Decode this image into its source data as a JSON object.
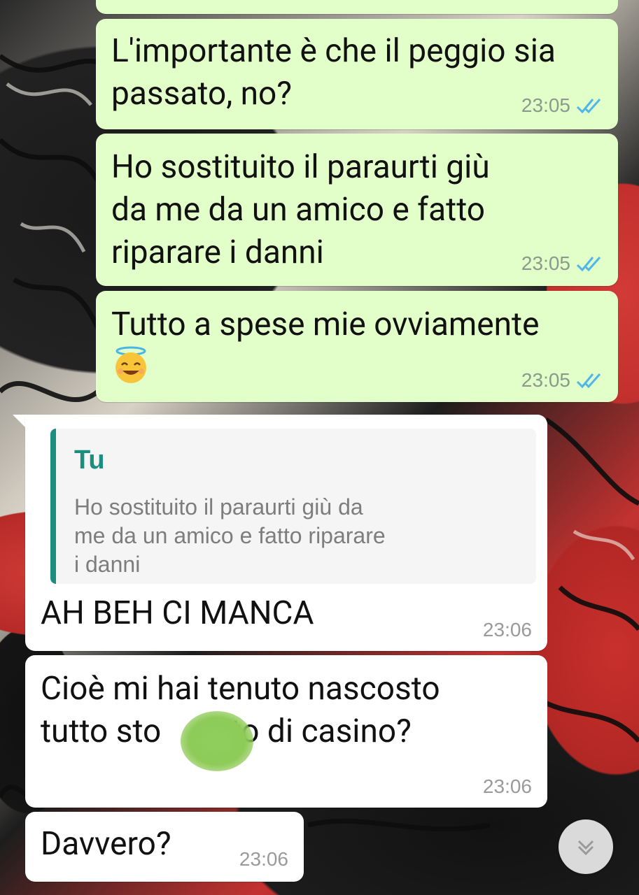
{
  "messages": [
    {
      "direction": "outgoing",
      "lines": [
        "L'importante è che il peggio sia",
        "passato, no?"
      ],
      "time": "23:05",
      "status": "read-double-check"
    },
    {
      "direction": "outgoing",
      "lines": [
        "Ho sostituito il paraurti giù",
        "da me da un amico e fatto",
        "riparare i danni"
      ],
      "time": "23:05",
      "status": "read-double-check"
    },
    {
      "direction": "outgoing",
      "lines": [
        "Tutto a spese mie ovviamente"
      ],
      "emoji": "smiling-face-with-halo",
      "time": "23:05",
      "status": "read-double-check"
    },
    {
      "direction": "incoming",
      "quote": {
        "author": "Tu",
        "text": "Ho sostituito il paraurti giù da\nme da un amico e fatto riparare\ni danni"
      },
      "lines": [
        "AH BEH CI MANCA"
      ],
      "time": "23:06"
    },
    {
      "direction": "incoming",
      "lines": [
        "Cioè mi hai tenuto nascosto"
      ],
      "line2_before": "tutto sto ",
      "line2_after": "to di casino?",
      "censored": true,
      "time": "23:06"
    },
    {
      "direction": "incoming",
      "lines": [
        "Davvero?"
      ],
      "time": "23:06"
    }
  ],
  "icons": {
    "read_receipt": "double-check-icon",
    "scroll_down": "chevron-double-down-icon",
    "emoji": "smiling-face-with-halo-icon"
  },
  "colors": {
    "outgoing_bubble": "#e2fec9",
    "incoming_bubble": "#ffffff",
    "read_tick": "#4fb6ec",
    "quote_accent": "#1a8f7e",
    "censor_blob": "#8ecb58"
  }
}
